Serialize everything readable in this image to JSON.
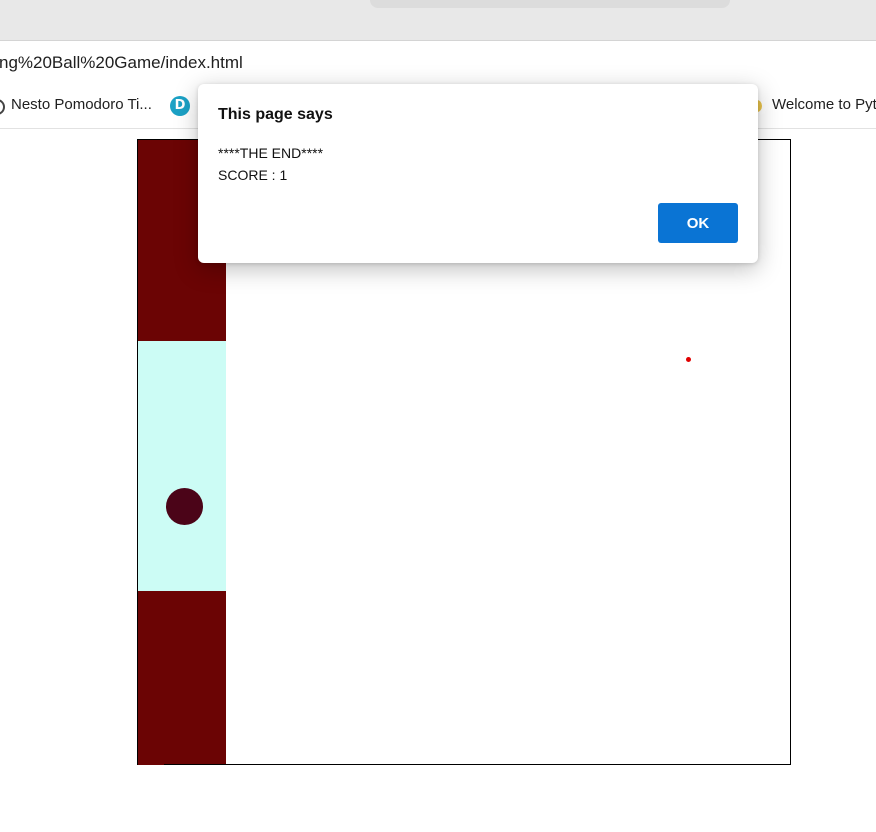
{
  "browser": {
    "address": "ng%20Ball%20Game/index.html",
    "bookmarks": [
      {
        "label": "Nesto Pomodoro Ti..."
      },
      {
        "label": "Welcome to Pyt"
      }
    ]
  },
  "dialog": {
    "title": "This page says",
    "message_line1": "****THE END****",
    "message_line2": "SCORE : 1",
    "ok_label": "OK"
  },
  "colors": {
    "wall": "#6b0404",
    "paddle_zone": "#ccfcf5",
    "ball": "#4b0418",
    "ok_button": "#0a74d4",
    "small_ball": "#e00000"
  },
  "icons": {
    "bookmark_1": "edge-icon",
    "bookmark_2": "d-logo-icon",
    "bookmark_3": "python-icon"
  }
}
